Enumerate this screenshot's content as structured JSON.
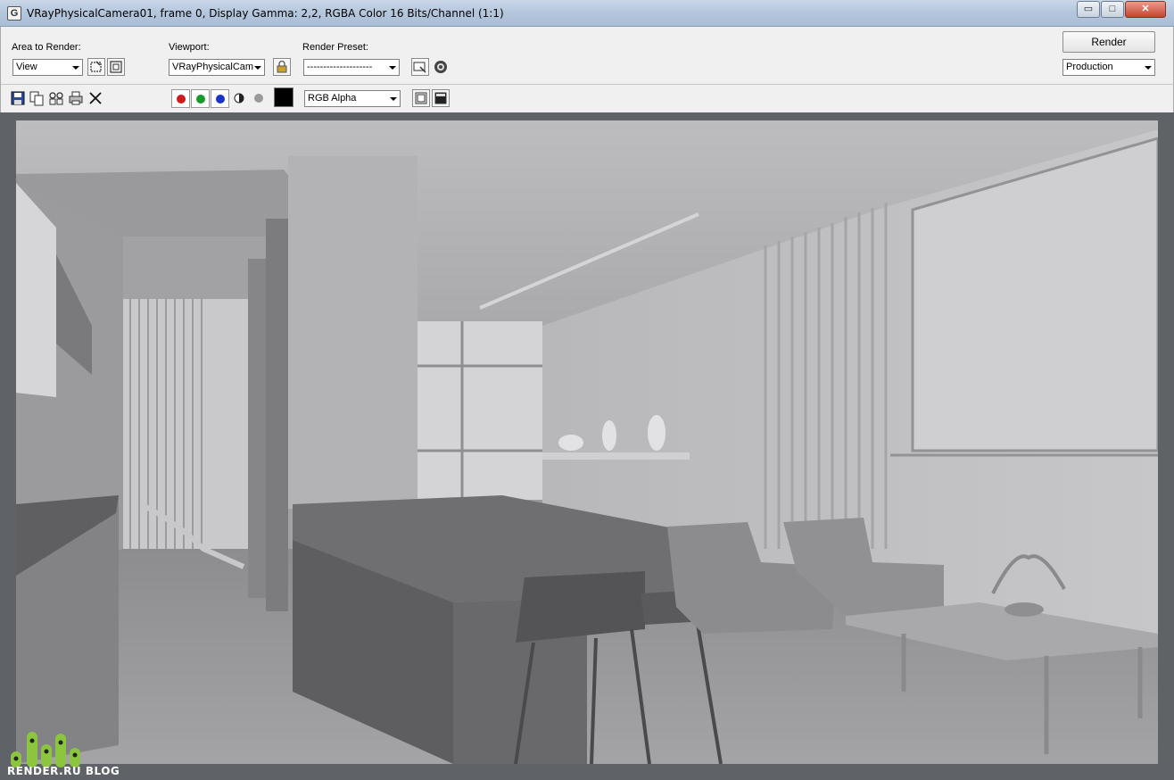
{
  "window": {
    "title": "VRayPhysicalCamera01, frame 0, Display Gamma: 2,2, RGBA Color 16 Bits/Channel (1:1)",
    "app_icon": "G",
    "minimize_glyph": "▭",
    "maximize_glyph": "□",
    "close_glyph": "✕"
  },
  "toolbar": {
    "area_label": "Area to Render:",
    "area_value": "View",
    "viewport_label": "Viewport:",
    "viewport_value": "VRayPhysicalCam",
    "preset_label": "Render Preset:",
    "preset_value": "--------------------",
    "render_button": "Render",
    "mode_value": "Production",
    "channel_value": "RGB Alpha"
  },
  "icons": {
    "save": "save-icon",
    "copy": "copy-icon",
    "clone": "clone-window-icon",
    "print": "print-icon",
    "clear": "clear-icon",
    "red": "red-channel-icon",
    "green": "green-channel-icon",
    "blue": "blue-channel-icon",
    "mono": "monochrome-icon",
    "alpha": "alpha-channel-icon"
  },
  "colors": {
    "red_channel": "#d11a1a",
    "green_channel": "#179a2a",
    "blue_channel": "#1a34c8",
    "swatch": "#000000",
    "logo_green": "#8cc63f"
  },
  "watermark": {
    "text": "RENDER.RU BLOG"
  }
}
